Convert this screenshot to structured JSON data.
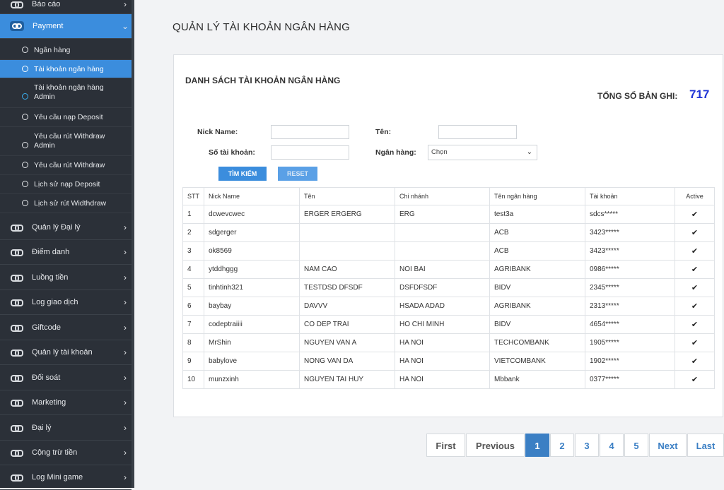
{
  "sidebar": {
    "top_partial": "Báo cáo",
    "payment": "Payment",
    "sub_items": [
      "Ngân hàng",
      "Tài khoản ngân hàng",
      "Tài khoản ngân hàng Admin",
      "Yêu cầu nạp Deposit",
      "Yêu cầu rút Withdraw Admin",
      "Yêu cầu rút Withdraw",
      "Lịch sử nạp Deposit",
      "Lịch sử rút Widthdraw"
    ],
    "items": [
      "Quản lý Đại lý",
      "Điểm danh",
      "Luồng tiền",
      "Log giao dịch",
      "Giftcode",
      "Quản lý tài khoản",
      "Đối soát",
      "Marketing",
      "Đại lý",
      "Cộng trừ tiền",
      "Log Mini game"
    ]
  },
  "page": {
    "title": "QUẢN LÝ TÀI KHOẢN NGÂN HÀNG",
    "list_title": "DANH SÁCH TÀI KHOẢN NGÂN HÀNG",
    "total_label": "TỔNG SỐ BẢN GHI:",
    "total_value": "717"
  },
  "filters": {
    "nickname_label": "Nick Name:",
    "name_label": "Tên:",
    "account_label": "Số tài khoản:",
    "bank_label": "Ngân hàng:",
    "bank_selected": "Chọn",
    "search_button": "TÌM KIẾM",
    "reset_button": "RESET"
  },
  "table": {
    "headers": [
      "STT",
      "Nick Name",
      "Tên",
      "Chi nhánh",
      "Tên ngân hàng",
      "Tài khoản",
      "Active"
    ],
    "rows": [
      [
        "1",
        "dcwevcwec",
        "ERGER ERGERG",
        "ERG",
        "test3a",
        "sdcs*****"
      ],
      [
        "2",
        "sdgerger",
        "",
        "",
        "ACB",
        "3423*****"
      ],
      [
        "3",
        "ok8569",
        "",
        "",
        "ACB",
        "3423*****"
      ],
      [
        "4",
        "ytddhggg",
        "NAM CAO",
        "NOI BAI",
        "AGRIBANK",
        "0986*****"
      ],
      [
        "5",
        "tinhtinh321",
        "TESTDSD DFSDF",
        "DSFDFSDF",
        "BIDV",
        "2345*****"
      ],
      [
        "6",
        "baybay",
        "DAVVV",
        "HSADA ADAD",
        "AGRIBANK",
        "2313*****"
      ],
      [
        "7",
        "codeptraiiii",
        "CO DEP TRAI",
        "HO CHI MINH",
        "BIDV",
        "4654*****"
      ],
      [
        "8",
        "MrShin",
        "NGUYEN VAN A",
        "HA NOI",
        "TECHCOMBANK",
        "1905*****"
      ],
      [
        "9",
        "babylove",
        "NONG VAN DA",
        "HA NOI",
        "VIETCOMBANK",
        "1902*****"
      ],
      [
        "10",
        "munzxinh",
        "NGUYEN TAI HUY",
        "HA NOI",
        "Mbbank",
        "0377*****"
      ]
    ]
  },
  "pagination": {
    "first": "First",
    "previous": "Previous",
    "pages": [
      "1",
      "2",
      "3",
      "4",
      "5"
    ],
    "next": "Next",
    "last": "Last"
  },
  "colors": {
    "sidebar_bg": "#2b3038",
    "accent": "#3b8ddd",
    "total": "#1f34d6"
  }
}
